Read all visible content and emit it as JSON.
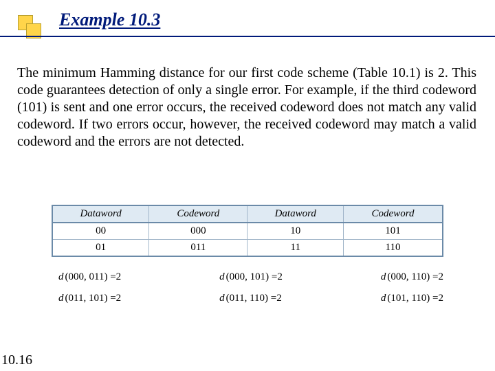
{
  "heading": "Example 10.3",
  "paragraph": "The minimum Hamming distance for our first code scheme (Table 10.1) is 2. This code guarantees detection of only a single error. For example, if the third codeword (101) is sent and one error occurs, the received codeword does not match any valid codeword. If two errors occur, however, the received codeword may match a valid codeword and the errors are not detected.",
  "table": {
    "headers": [
      "Dataword",
      "Codeword",
      "Dataword",
      "Codeword"
    ],
    "rows": [
      [
        "00",
        "000",
        "10",
        "101"
      ],
      [
        "01",
        "011",
        "11",
        "110"
      ]
    ]
  },
  "distances": {
    "col1": [
      {
        "d": "d",
        "args": "(000, 011)",
        "val": "=2"
      },
      {
        "d": "d",
        "args": "(011, 101)",
        "val": "=2"
      }
    ],
    "col2": [
      {
        "d": "d",
        "args": "(000, 101)",
        "val": "=2"
      },
      {
        "d": "d",
        "args": "(011, 110)",
        "val": "=2"
      }
    ],
    "col3": [
      {
        "d": "d",
        "args": "(000, 110)",
        "val": "=2"
      },
      {
        "d": "d",
        "args": "(101, 110)",
        "val": "=2"
      }
    ]
  },
  "slide_number": "10.16"
}
